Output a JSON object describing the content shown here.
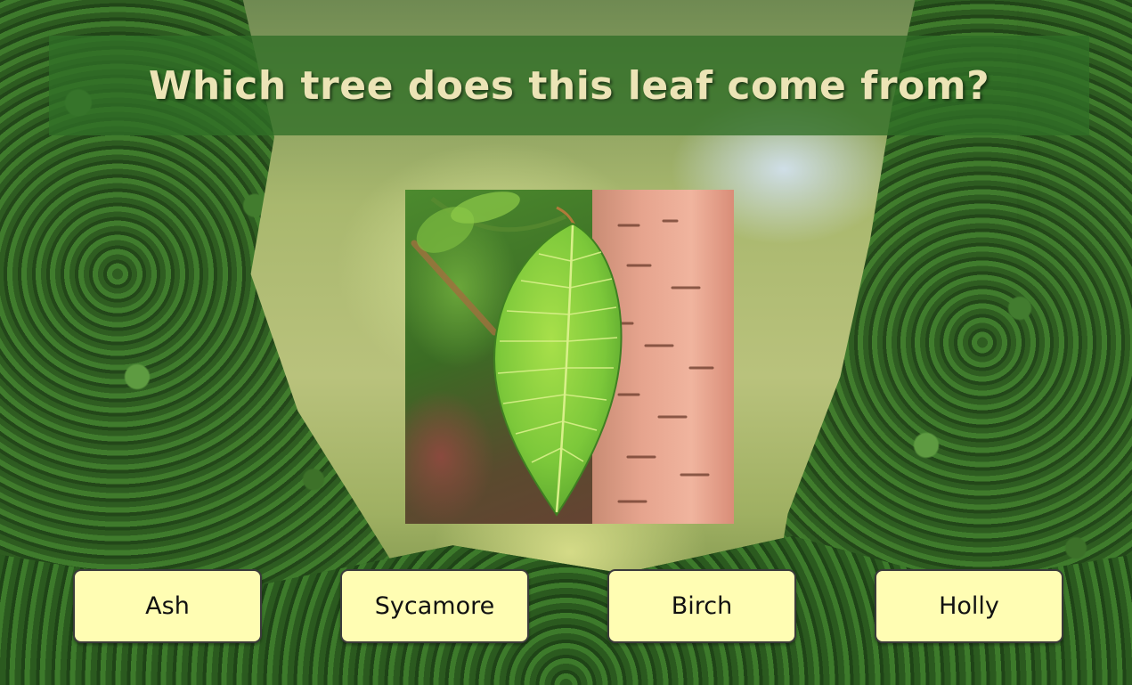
{
  "quiz": {
    "question": "Which tree does this leaf come from?",
    "image_subject": "leaf-on-birch-trunk",
    "answers": [
      {
        "label": "Ash"
      },
      {
        "label": "Sycamore"
      },
      {
        "label": "Birch"
      },
      {
        "label": "Holly"
      }
    ]
  },
  "colors": {
    "banner_background": "#306e26",
    "question_text": "#ece4b6",
    "answer_background": "#fffdb3",
    "answer_border": "#3b3b3b",
    "answer_text": "#111111"
  }
}
